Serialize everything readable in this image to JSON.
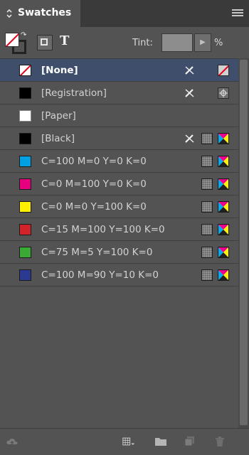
{
  "panel": {
    "tab_title": "Swatches",
    "tint_label": "Tint:",
    "tint_value": "",
    "tint_unit": "%",
    "text_toggle": "T"
  },
  "swatches": [
    {
      "label": "[None]",
      "chip": "none",
      "selected": true,
      "icons": [
        "pencil-cross-icon",
        "none-swatch-icon"
      ]
    },
    {
      "label": "[Registration]",
      "chip": "#000000",
      "selected": false,
      "icons": [
        "pencil-cross-icon",
        "registration-mark-icon"
      ]
    },
    {
      "label": "[Paper]",
      "chip": "#ffffff",
      "selected": false,
      "icons": []
    },
    {
      "label": "[Black]",
      "chip": "#000000",
      "selected": false,
      "icons": [
        "pencil-cross-icon",
        "process-color-icon",
        "cmyk-mode-icon"
      ]
    },
    {
      "label": "C=100 M=0 Y=0 K=0",
      "chip": "#00a0e3",
      "selected": false,
      "icons": [
        "process-color-icon",
        "cmyk-mode-icon"
      ]
    },
    {
      "label": "C=0 M=100 Y=0 K=0",
      "chip": "#e5007e",
      "selected": false,
      "icons": [
        "process-color-icon",
        "cmyk-mode-icon"
      ]
    },
    {
      "label": "C=0 M=0 Y=100 K=0",
      "chip": "#fff000",
      "selected": false,
      "icons": [
        "process-color-icon",
        "cmyk-mode-icon"
      ]
    },
    {
      "label": "C=15 M=100 Y=100 K=0",
      "chip": "#d2232a",
      "selected": false,
      "icons": [
        "process-color-icon",
        "cmyk-mode-icon"
      ]
    },
    {
      "label": "C=75 M=5 Y=100 K=0",
      "chip": "#3aaa35",
      "selected": false,
      "icons": [
        "process-color-icon",
        "cmyk-mode-icon"
      ]
    },
    {
      "label": "C=100 M=90 Y=10 K=0",
      "chip": "#2b3990",
      "selected": false,
      "icons": [
        "process-color-icon",
        "cmyk-mode-icon"
      ]
    }
  ],
  "colors": {
    "panel_bg": "#535353",
    "selection": "#3f4f6b",
    "none_red": "#e0001a"
  }
}
